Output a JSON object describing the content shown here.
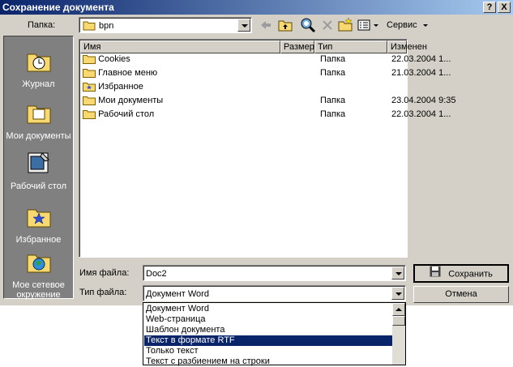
{
  "window": {
    "title": "Сохранение документа",
    "help_button": "?",
    "close_button": "X"
  },
  "toolbar": {
    "folder_label": "Папка:",
    "folder_value": "bpn",
    "service_label": "Сервис"
  },
  "sidebar": {
    "items": [
      {
        "label": "Журнал",
        "icon": "history-folder-icon"
      },
      {
        "label": "Мои документы",
        "icon": "my-documents-icon"
      },
      {
        "label": "Рабочий стол",
        "icon": "desktop-icon"
      },
      {
        "label": "Избранное",
        "icon": "favorites-folder-icon"
      },
      {
        "label": "Мое сетевое окружение",
        "icon": "network-places-icon"
      }
    ]
  },
  "filelist": {
    "columns": [
      "Имя",
      "Размер",
      "Тип",
      "Изменен"
    ],
    "rows": [
      {
        "name": "Cookies",
        "size": "",
        "type": "Папка",
        "modified": "22.03.2004 1...",
        "icon": "folder"
      },
      {
        "name": "Главное меню",
        "size": "",
        "type": "Папка",
        "modified": "21.03.2004 1...",
        "icon": "folder"
      },
      {
        "name": "Избранное",
        "size": "",
        "type": "",
        "modified": "",
        "icon": "favorites"
      },
      {
        "name": "Мои документы",
        "size": "",
        "type": "Папка",
        "modified": "23.04.2004 9:35",
        "icon": "folder"
      },
      {
        "name": "Рабочий стол",
        "size": "",
        "type": "Папка",
        "modified": "22.03.2004 1...",
        "icon": "folder"
      }
    ]
  },
  "form": {
    "filename_label": "Имя файла:",
    "filename_value": "Doc2",
    "filetype_label": "Тип файла:",
    "filetype_value": "Документ Word",
    "save_button": "Сохранить",
    "cancel_button": "Отмена"
  },
  "dropdown": {
    "options": [
      "Документ Word",
      "Web-страница",
      "Шаблон документа",
      "Текст в формате RTF",
      "Только текст",
      "Текст с разбиением на строки"
    ],
    "selected_index": 3
  },
  "colors": {
    "title_bar": "#0a246a",
    "dialog_bg": "#d4d0c8",
    "sidebar_bg": "#808080",
    "selection": "#0a246a",
    "folder_yellow": "#f8d870"
  }
}
